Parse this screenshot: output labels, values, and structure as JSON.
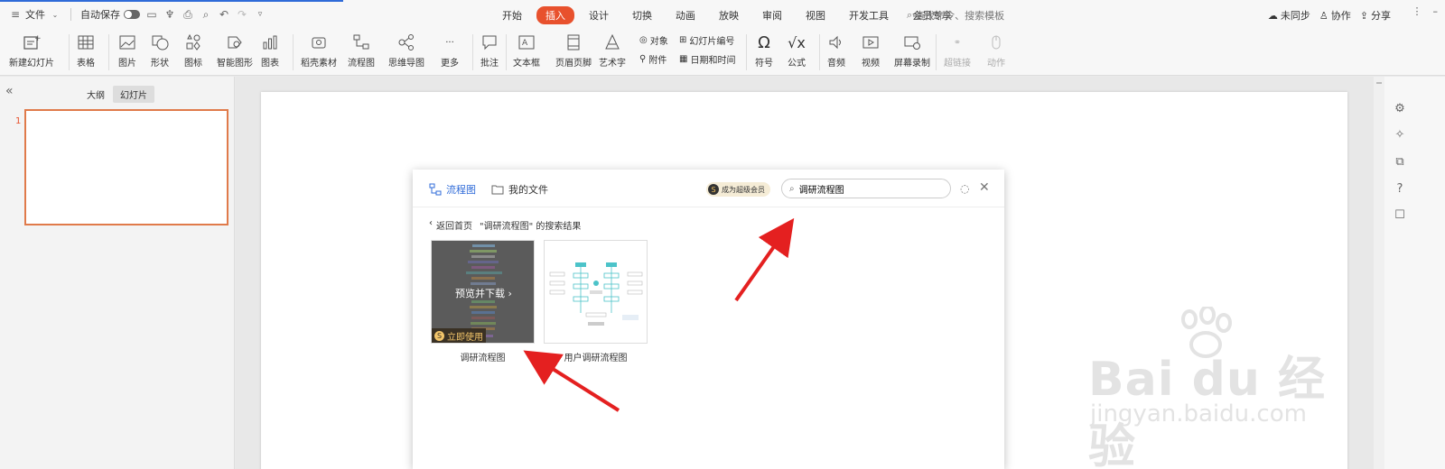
{
  "topbar": {
    "file": "文件",
    "autosave": "自动保存",
    "tabs": [
      {
        "label": "开始"
      },
      {
        "label": "插入"
      },
      {
        "label": "设计"
      },
      {
        "label": "切换"
      },
      {
        "label": "动画"
      },
      {
        "label": "放映"
      },
      {
        "label": "审阅"
      },
      {
        "label": "视图"
      },
      {
        "label": "开发工具"
      },
      {
        "label": "会员专享"
      }
    ],
    "active_tab": "插入",
    "search_placeholder": "查找命令、搜索模板",
    "right": {
      "unsync": "未同步",
      "collab": "协作",
      "share": "分享"
    },
    "accent_color": "#e8512d"
  },
  "ribbon": {
    "new_slide": "新建幻灯片",
    "table": "表格",
    "picture": "图片",
    "shape": "形状",
    "icon": "图标",
    "smart_graphic": "智能图形",
    "chart": "图表",
    "shell_material": "稻壳素材",
    "flowchart": "流程图",
    "mindmap": "思维导图",
    "more": "更多",
    "comment": "批注",
    "textbox": "文本框",
    "header_footer": "页眉页脚",
    "wordart": "艺术字",
    "object": "对象",
    "attachment": "附件",
    "slide_number": "幻灯片编号",
    "datetime": "日期和时间",
    "symbol": "符号",
    "formula": "公式",
    "audio": "音频",
    "video": "视频",
    "screen_record": "屏幕录制",
    "hyperlink": "超链接",
    "action": "动作"
  },
  "left_panel": {
    "outline": "大纲",
    "slides": "幻灯片",
    "slide_number": "1"
  },
  "dialog": {
    "tab_flowchart": "流程图",
    "tab_myfiles": "我的文件",
    "vip": "成为超级会员",
    "search_value": "调研流程图",
    "back": "返回首页",
    "results_label": "\"调研流程图\" 的搜索结果",
    "cards": [
      {
        "caption": "调研流程图",
        "overlay": "预览并下载 ›",
        "badge": "立即使用"
      },
      {
        "caption": "用户调研流程图"
      }
    ]
  },
  "watermark": {
    "brand": "Bai du 经验",
    "url": "jingyan.baidu.com"
  }
}
